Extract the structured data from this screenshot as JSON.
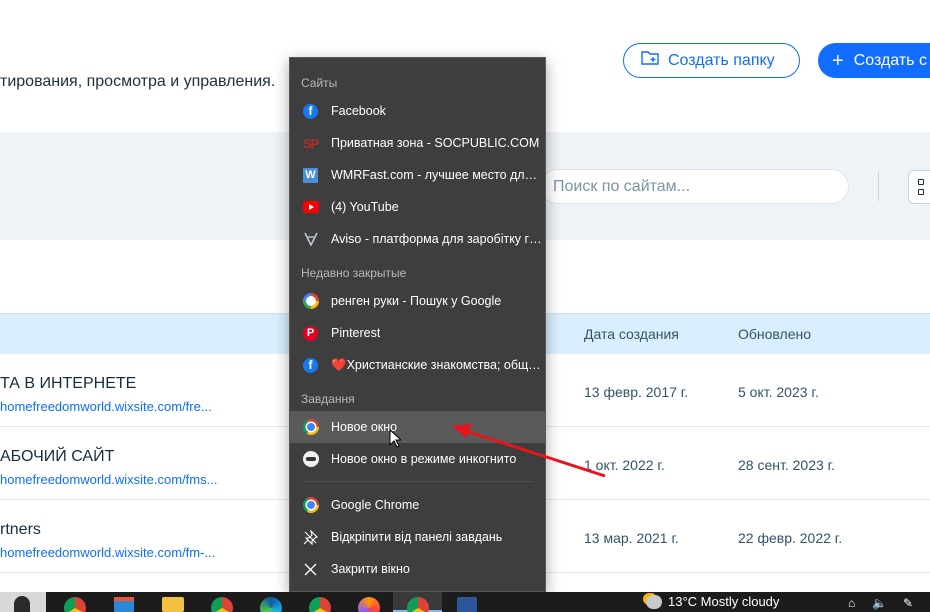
{
  "page": {
    "subtitle": "тирования, просмотра и управления.",
    "create_folder_label": "Создать папку",
    "create_site_label": "Создать с",
    "search_placeholder": "Поиск по сайтам...",
    "columns": {
      "created": "Дата создания",
      "updated": "Обновлено"
    },
    "rows": [
      {
        "name": "ТА В ИНТЕРНЕТЕ",
        "url": "homefreedomworld.wixsite.com/fre...",
        "created": "13 февр. 2017 г.",
        "updated": "5 окт. 2023 г."
      },
      {
        "name": "АБОЧИЙ САЙТ",
        "url": "homefreedomworld.wixsite.com/fms...",
        "created": "1 окт. 2022 г.",
        "updated": "28 сент. 2023 г."
      },
      {
        "name": "rtners",
        "url": "homefreedomworld.wixsite.com/fm-...",
        "created": "13 мар. 2021 г.",
        "updated": "22 февр. 2022 г."
      }
    ]
  },
  "jumplist": {
    "sites_header": "Сайты",
    "sites": [
      {
        "label": "Facebook",
        "icon": "facebook-icon"
      },
      {
        "label": "Приватная зона - SOCPUBLIC.COM",
        "icon": "socpublic-icon"
      },
      {
        "label": "WMRFast.com - лучшее место для за...",
        "icon": "wmrfast-icon"
      },
      {
        "label": "(4) YouTube",
        "icon": "youtube-icon"
      },
      {
        "label": "Aviso - платформа для заробітку гро...",
        "icon": "aviso-icon"
      }
    ],
    "recent_header": "Недавно закрытые",
    "recent": [
      {
        "label": "ренген руки - Пошук у Google",
        "icon": "google-icon"
      },
      {
        "label": "Pinterest",
        "icon": "pinterest-icon"
      },
      {
        "label": "❤️Христианские знакомства; общен...",
        "icon": "facebook-icon"
      }
    ],
    "tasks_header": "Завдання",
    "tasks": [
      {
        "label": "Новое окно",
        "icon": "chrome-icon"
      },
      {
        "label": "Новое окно в режиме инкогнито",
        "icon": "incognito-icon"
      }
    ],
    "app": [
      {
        "label": "Google Chrome",
        "icon": "chrome-icon"
      },
      {
        "label": "Відкріпити від панелі завдань",
        "icon": "unpin-icon"
      },
      {
        "label": "Закрити вікно",
        "icon": "close-icon"
      }
    ]
  },
  "taskbar": {
    "weather": "13°C  Mostly cloudy"
  },
  "colors": {
    "accent": "#116dff",
    "menu_bg": "#3e3e3e",
    "annotation_arrow": "#e8141c"
  }
}
